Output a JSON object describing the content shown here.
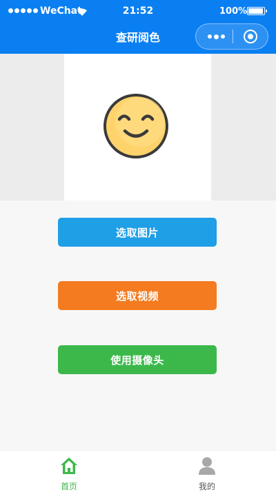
{
  "status_bar": {
    "carrier": "WeChat",
    "time": "21:52",
    "battery_percent": "100%",
    "battery_level": 1.0
  },
  "nav": {
    "title": "查研阅色"
  },
  "preview": {
    "image": "smiling-face-emoji"
  },
  "actions": {
    "pick_image": "选取图片",
    "pick_video": "选取视频",
    "use_camera": "使用摄像头"
  },
  "colors": {
    "header": "#0a7ff2",
    "pick_image": "#1e9fe6",
    "pick_video": "#f47b20",
    "use_camera": "#3cb84b",
    "tab_active": "#3cb84b"
  },
  "tabs": [
    {
      "label": "首页",
      "icon": "home-icon",
      "active": true
    },
    {
      "label": "我的",
      "icon": "user-icon",
      "active": false
    }
  ]
}
